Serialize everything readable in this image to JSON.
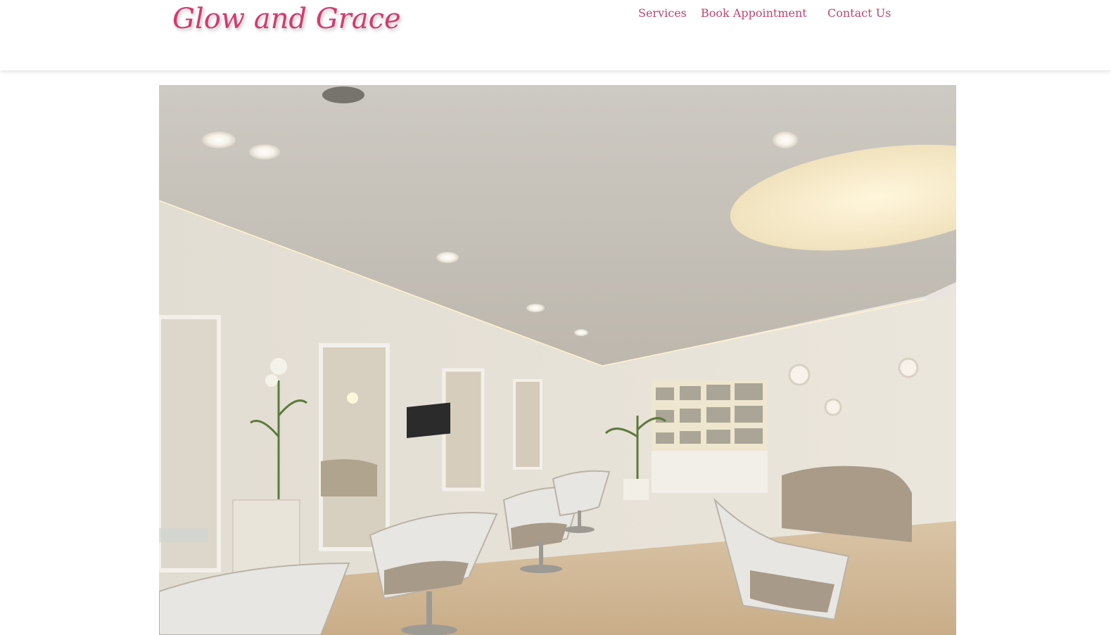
{
  "site": {
    "brand": "Glow and Grace"
  },
  "nav": {
    "items": [
      "Services",
      "Book Appointment",
      "Contact Us"
    ]
  },
  "hero": {
    "image_label": "salon-interior-photo"
  },
  "colors": {
    "brand": "#d23b70",
    "nav_link": "#c5426f",
    "header_bg": "#ffffff"
  }
}
